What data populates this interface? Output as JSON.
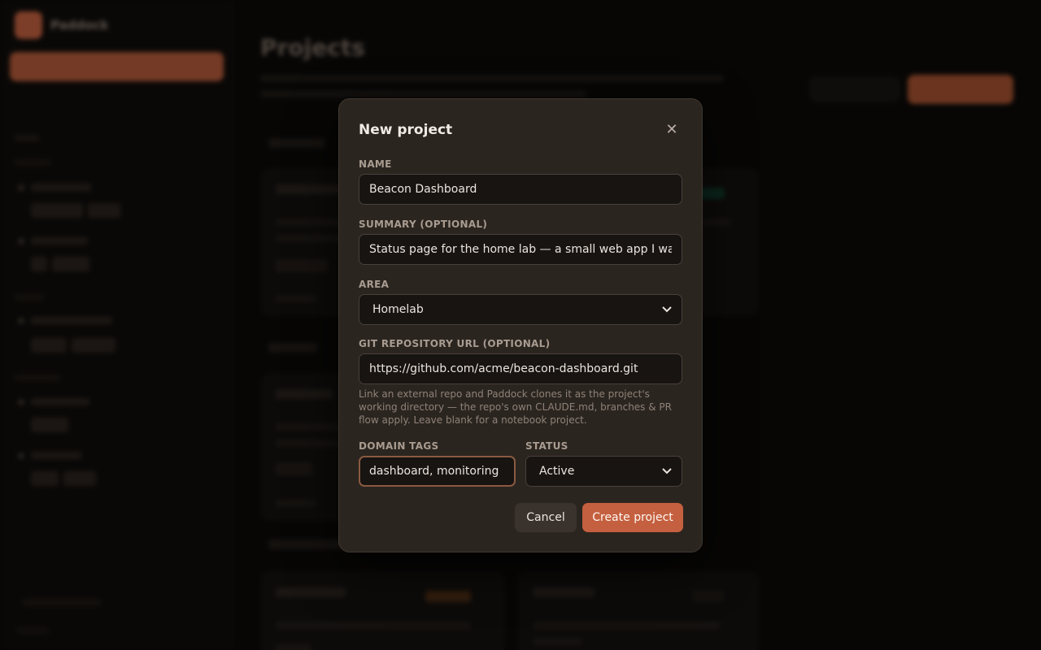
{
  "modal": {
    "title": "New project",
    "close_glyph": "✕",
    "close_icon": "close-icon",
    "fields": {
      "name": {
        "label": "NAME",
        "value": "Beacon Dashboard"
      },
      "summary": {
        "label": "SUMMARY (OPTIONAL)",
        "value": "Status page for the home lab — a small web app I want t"
      },
      "area": {
        "label": "AREA",
        "selected": "Homelab"
      },
      "git_url": {
        "label": "GIT REPOSITORY URL (OPTIONAL)",
        "value": "https://github.com/acme/beacon-dashboard.git",
        "help": "Link an external repo and Paddock clones it as the project's working directory — the repo's own CLAUDE.md, branches & PR flow apply. Leave blank for a notebook project."
      },
      "domain_tags": {
        "label": "DOMAIN TAGS",
        "value": "dashboard, monitoring"
      },
      "status": {
        "label": "STATUS",
        "selected": "Active"
      }
    },
    "cancel_label": "Cancel",
    "create_label": "Create project"
  },
  "background": {
    "brand_name": "Paddock",
    "page_title": "Projects"
  },
  "colors": {
    "accent": "#c4603f",
    "modal_bg": "#2b2520",
    "input_bg": "#171412",
    "focus_border": "#8a5a40"
  }
}
